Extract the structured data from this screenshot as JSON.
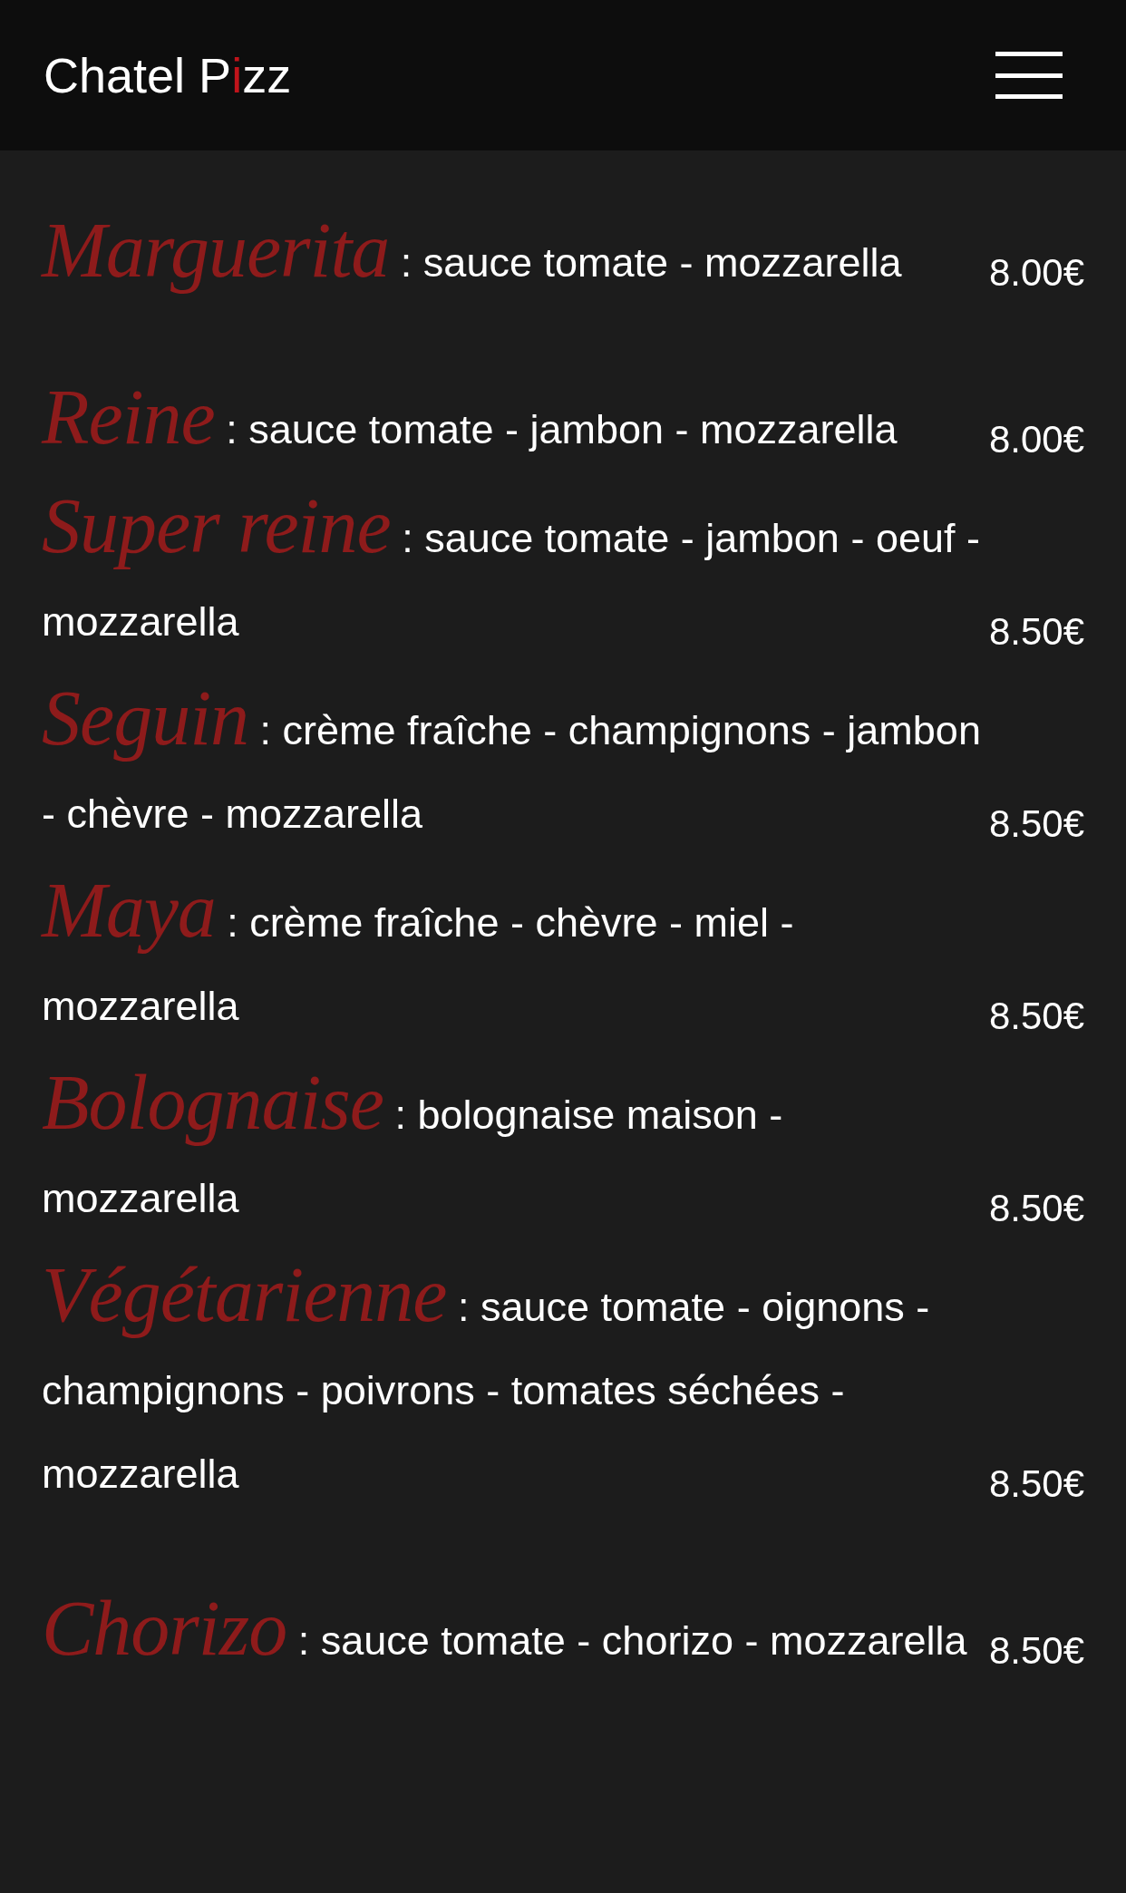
{
  "header": {
    "title_parts": [
      {
        "text": "Chatel P",
        "accent": false
      },
      {
        "text": "i",
        "accent": true
      },
      {
        "text": "zz",
        "accent": false
      }
    ]
  },
  "menu": [
    {
      "name": "Marguerita",
      "description": ": sauce tomate - mozzarella",
      "price": "8.00€"
    },
    {
      "name": "Reine",
      "description": ": sauce tomate - jambon - mozzarella",
      "price": "8.00€"
    },
    {
      "name": "Super reine",
      "description": ": sauce tomate - jambon - oeuf - mozzarella",
      "price": "8.50€"
    },
    {
      "name": "Seguin",
      "description": ": crème fraîche - champignons - jambon - chèvre - mozzarella",
      "price": "8.50€"
    },
    {
      "name": "Maya",
      "description": ": crème fraîche - chèvre - miel - mozzarella",
      "price": "8.50€"
    },
    {
      "name": "Bolognaise",
      "description": ": bolognaise maison - mozzarella",
      "price": "8.50€"
    },
    {
      "name": "Végétarienne",
      "description": ": sauce tomate - oignons - champignons - poivrons - tomates séchées - mozzarella",
      "price": "8.50€"
    },
    {
      "name": "Chorizo",
      "description": ": sauce tomate - chorizo - mozzarella",
      "price": "8.50€"
    }
  ]
}
